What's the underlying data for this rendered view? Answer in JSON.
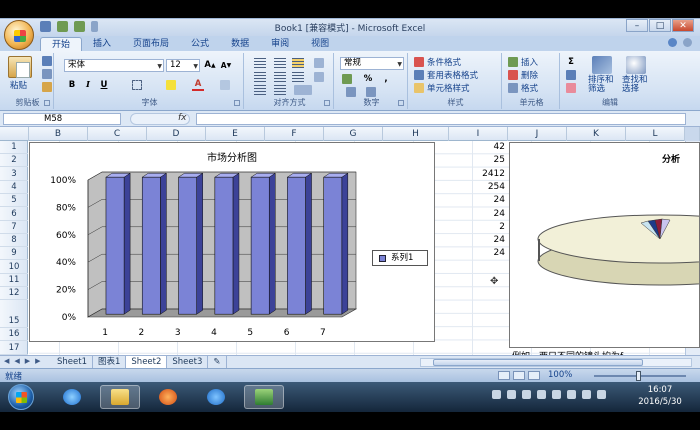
{
  "window": {
    "title": "Book1 [兼容模式] - Microsoft Excel"
  },
  "ribbon": {
    "tabs": [
      "开始",
      "插入",
      "页面布局",
      "公式",
      "数据",
      "审阅",
      "视图"
    ],
    "clipboard": {
      "paste": "粘贴",
      "group": "剪贴板"
    },
    "font": {
      "name": "宋体",
      "size": "12",
      "group": "字体"
    },
    "alignment": {
      "group": "对齐方式"
    },
    "number": {
      "format": "常规",
      "group": "数字"
    },
    "styles": {
      "conditional": "条件格式",
      "table": "套用表格格式",
      "cell": "单元格样式",
      "group": "样式"
    },
    "cells": {
      "insert": "插入",
      "delete": "删除",
      "format": "格式",
      "group": "单元格"
    },
    "editing": {
      "sort": "排序和\n筛选",
      "find": "查找和\n选择",
      "group": "编辑"
    }
  },
  "formula_bar": {
    "name_box": "M58",
    "fx": "fx"
  },
  "columns": [
    "B",
    "C",
    "D",
    "E",
    "F",
    "G",
    "H",
    "I",
    "J",
    "K",
    "L"
  ],
  "rows": [
    "1",
    "2",
    "3",
    "4",
    "5",
    "6",
    "7",
    "8",
    "9",
    "10",
    "11",
    "12",
    "15",
    "16",
    "17"
  ],
  "column_i_values": [
    "42",
    "25",
    "2412",
    "254",
    "24",
    "24",
    "2",
    "24",
    "24"
  ],
  "chart_data": {
    "type": "bar",
    "title": "市场分析图",
    "categories": [
      "1",
      "2",
      "3",
      "4",
      "5",
      "6",
      "7"
    ],
    "series": [
      {
        "name": "系列1",
        "values": [
          100,
          100,
          100,
          100,
          100,
          100,
          100
        ]
      }
    ],
    "ylim": [
      0,
      100
    ],
    "yticks": [
      "0%",
      "20%",
      "40%",
      "60%",
      "80%",
      "100%"
    ],
    "legend": "right",
    "style": "3d",
    "bar_color": "#7b83d6"
  },
  "chart2": {
    "title": "分析",
    "type": "pie-3d"
  },
  "caption": "例如，两只不同的镜头均为f",
  "sheets": [
    "Sheet1",
    "图表1",
    "Sheet2",
    "Sheet3"
  ],
  "active_sheet": "Sheet2",
  "status": {
    "ready": "就绪",
    "zoom": "100%"
  },
  "clock": {
    "time": "16:07",
    "date": "2016/5/30"
  }
}
